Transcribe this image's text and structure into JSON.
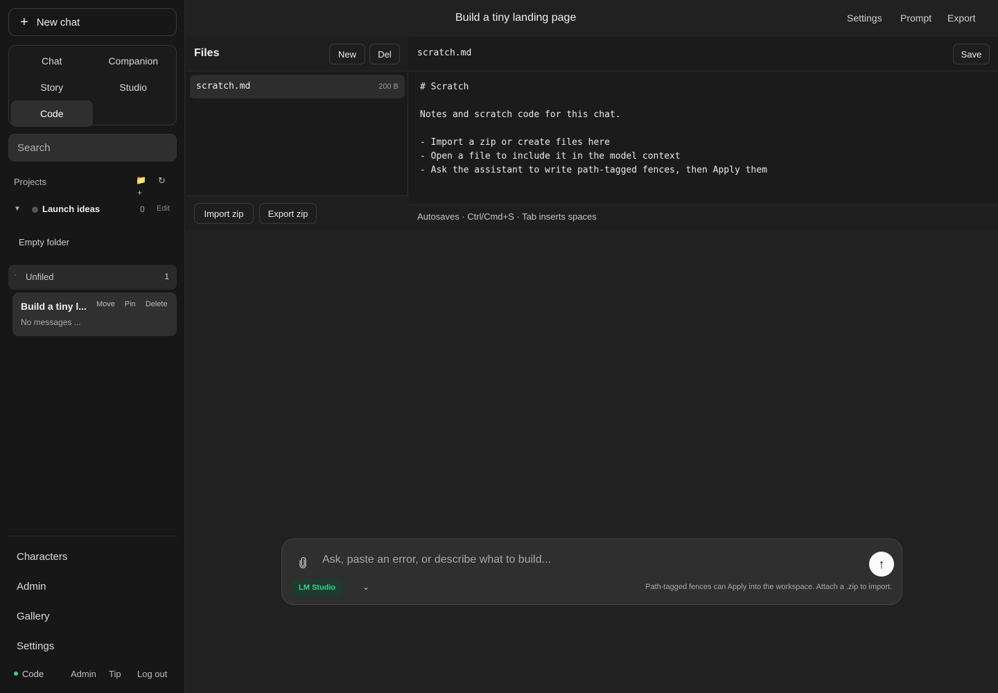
{
  "sidebar": {
    "new_chat": "New chat",
    "modes": [
      "Chat",
      "Companion",
      "Story",
      "Studio",
      "Code"
    ],
    "active_mode": "Code",
    "search_placeholder": "Search",
    "projects_label": "Projects",
    "project": {
      "name": "Launch ideas",
      "count": "0",
      "edit": "Edit"
    },
    "empty_folder": "Empty folder",
    "unfiled": {
      "label": "Unfiled",
      "count": "1"
    },
    "chat": {
      "title": "Build a tiny l...",
      "preview": "No messages ...",
      "move": "Move",
      "pin": "Pin",
      "delete": "Delete"
    },
    "nav": [
      "Characters",
      "Admin",
      "Gallery",
      "Settings"
    ],
    "footer": {
      "mode": "Code",
      "admin": "Admin",
      "tip": "Tip",
      "logout": "Log out"
    }
  },
  "header": {
    "title": "Build a tiny landing page",
    "links": [
      "Settings",
      "Prompt",
      "Export"
    ]
  },
  "files": {
    "title": "Files",
    "new": "New",
    "del": "Del",
    "items": [
      {
        "name": "scratch.md",
        "size": "200 B"
      }
    ],
    "import": "Import zip",
    "export": "Export zip"
  },
  "editor": {
    "filename": "scratch.md",
    "save": "Save",
    "content": "# Scratch\n\nNotes and scratch code for this chat.\n\n- Import a zip or create files here\n- Open a file to include it in the model context\n- Ask the assistant to write path-tagged fences, then Apply them",
    "footer": "Autosaves · Ctrl/Cmd+S · Tab inserts spaces"
  },
  "composer": {
    "placeholder": "Ask, paste an error, or describe what to build...",
    "model": "LM Studio",
    "hint": "Path-tagged fences can Apply into the workspace. Attach a .zip to import."
  },
  "colors": {
    "accent_green": "#3ecf8e",
    "folder": "#e6b84a",
    "background": "#212121",
    "sidebar": "#171717"
  }
}
